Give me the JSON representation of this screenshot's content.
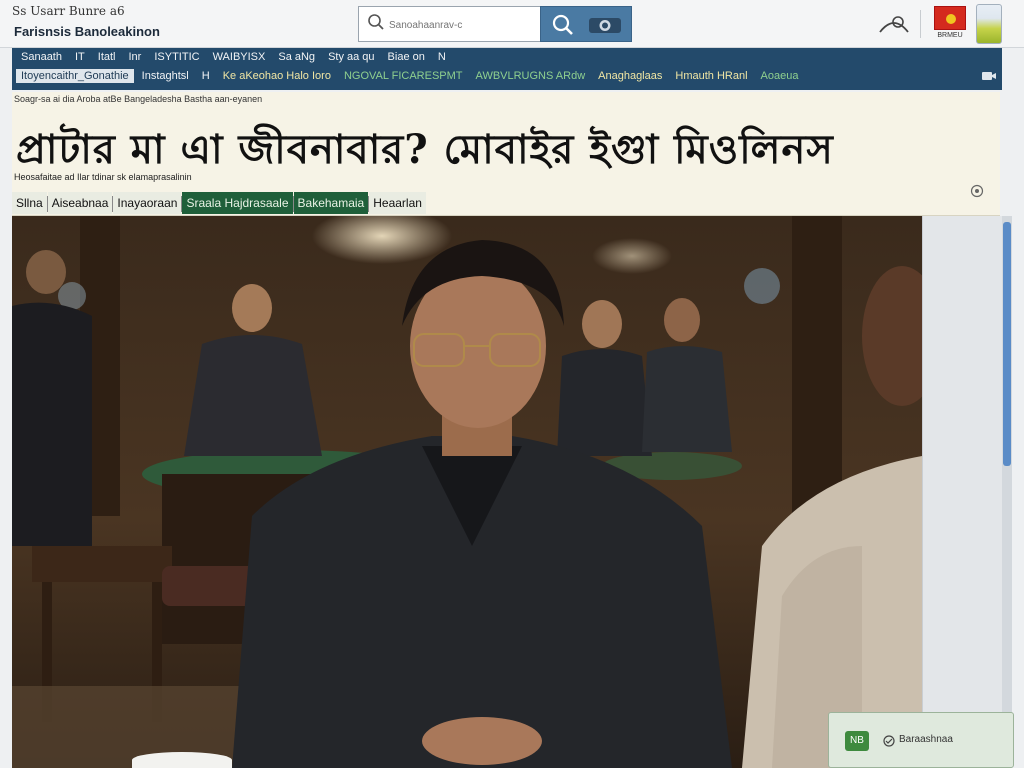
{
  "header": {
    "site_tag": "Ss Usarr Bunre a6",
    "site_name": "Farisnsis Banoleakinon"
  },
  "search": {
    "placeholder": "Sanoahaanrav-c"
  },
  "badge": {
    "label": "BRMEU"
  },
  "navbar": {
    "row1": [
      "Sanaath",
      "IT",
      "Itatl",
      "Inr",
      "ISYTITIC",
      "WAIBYISX",
      "Sa aNg",
      "Sty aa qu",
      "Biae on",
      "N"
    ],
    "row2": [
      {
        "label": "Itoyencaithr_Gonathie",
        "style": "hl"
      },
      {
        "label": "Instaghtsl",
        "style": ""
      },
      {
        "label": "H",
        "style": ""
      },
      {
        "label": "Ke aKeohao Halo Ioro",
        "style": "yl"
      },
      {
        "label": "NGOVAL FICARESPMT",
        "style": "gr"
      },
      {
        "label": "AWBVLRUGNS ARdw",
        "style": "gr"
      },
      {
        "label": "Anaghaglaas",
        "style": "yl"
      },
      {
        "label": "Hmauth HRanl",
        "style": "yl"
      },
      {
        "label": "Aoaeua",
        "style": "gr"
      }
    ]
  },
  "article": {
    "breadcrumb": "Soagr-sa ai dia Aroba atBe Bangeladesha Bastha aan-eyanen",
    "headline": "প্রাটার মা এা জীবনাবার? মোবাইর ইগুা মিওলিনস",
    "byline": "Heosafaitae ad Ilar tdinar sk elamaprasalinin",
    "tags": [
      {
        "label": "Sllna",
        "style": "light"
      },
      {
        "label": "Aiseabnaa",
        "style": "light"
      },
      {
        "label": "Inayaoraan",
        "style": "light"
      },
      {
        "label": "Sraala Hajdrasaale",
        "style": "dark"
      },
      {
        "label": "Bakehamaia",
        "style": "dark"
      },
      {
        "label": "Heaarlan",
        "style": "light"
      }
    ]
  },
  "notification": {
    "badge": "NB",
    "text": "Baraashnaa"
  },
  "colors": {
    "nav_bg": "#234a6b",
    "search_btn": "#4a7aa3",
    "headline_bg": "#f6f3e6",
    "tag_dark": "#1f5f3a",
    "scroll_thumb": "#5b8cc7"
  },
  "icons": [
    "search-icon",
    "search-button-icon",
    "camera-icon",
    "user-icon",
    "flag-badge",
    "app-tile-icon",
    "video-camera-icon",
    "info-icon",
    "check-icon"
  ]
}
